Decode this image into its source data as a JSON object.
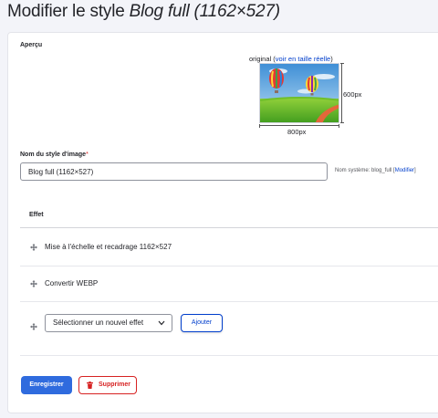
{
  "page": {
    "title_prefix": "Modifier le style ",
    "title_style_name": "Blog full (1162×527)"
  },
  "preview": {
    "label": "Aperçu",
    "caption_prefix": "original (",
    "caption_link": "voir en taille réelle",
    "caption_suffix": ")",
    "height_text": "600px",
    "width_text": "800px"
  },
  "name_field": {
    "label": "Nom du style d'image",
    "required_mark": "*",
    "value": "Blog full (1162×527)",
    "machine_name_prefix": "Nom système: blog_full [",
    "machine_name_link": "Modifier",
    "machine_name_suffix": "]"
  },
  "effects": {
    "column_header": "Effet",
    "items": [
      {
        "label": "Mise à l'échelle et recadrage 1162×527",
        "icon": "drag-handle-icon"
      },
      {
        "label": "Convertir WEBP",
        "icon": "drag-handle-icon"
      }
    ],
    "new_effect_select": "Sélectionner un nouvel effet",
    "add_button": "Ajouter"
  },
  "actions": {
    "save": "Enregistrer",
    "delete": "Supprimer"
  },
  "colors": {
    "accent": "#003ecc",
    "primary_button": "#2f6bde",
    "danger": "#d72222",
    "background": "#f3f4f9"
  }
}
